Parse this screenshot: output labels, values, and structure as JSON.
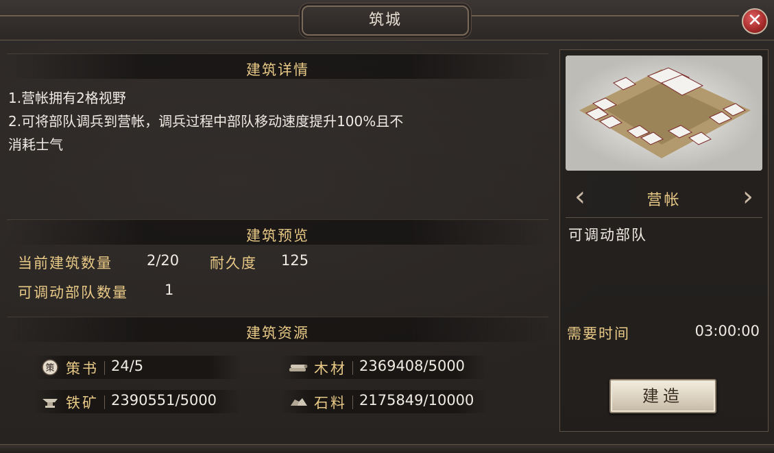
{
  "window": {
    "title": "筑城",
    "close_label": "✕"
  },
  "details": {
    "header": "建筑详情",
    "line1": "1.营帐拥有2格视野",
    "line2": "2.可将部队调兵到营帐，调兵过程中部队移动速度提升100%且不",
    "line3": "消耗士气"
  },
  "preview_section": {
    "header": "建筑预览",
    "current_count_label": "当前建筑数量",
    "current_count_value": "2/20",
    "durability_label": "耐久度",
    "durability_value": "125",
    "troop_count_label": "可调动部队数量",
    "troop_count_value": "1"
  },
  "resources": {
    "header": "建筑资源",
    "items": [
      {
        "icon": "policy-book-icon",
        "label": "策书",
        "value": "24/5",
        "icon_glyph": "策"
      },
      {
        "icon": "wood-icon",
        "label": "木材",
        "value": "2369408/5000"
      },
      {
        "icon": "iron-ore-icon",
        "label": "铁矿",
        "value": "2390551/5000"
      },
      {
        "icon": "stone-icon",
        "label": "石料",
        "value": "2175849/10000"
      }
    ]
  },
  "building": {
    "name": "营帐",
    "description": "可调动部队",
    "time_label": "需要时间",
    "time_value": "03:00:00",
    "build_button": "建造",
    "prev_arrow": "‹",
    "next_arrow": "›"
  },
  "colors": {
    "label_gold": "#e9c986",
    "value_text": "#f0ebe3",
    "close_red": "#a52a2a"
  }
}
